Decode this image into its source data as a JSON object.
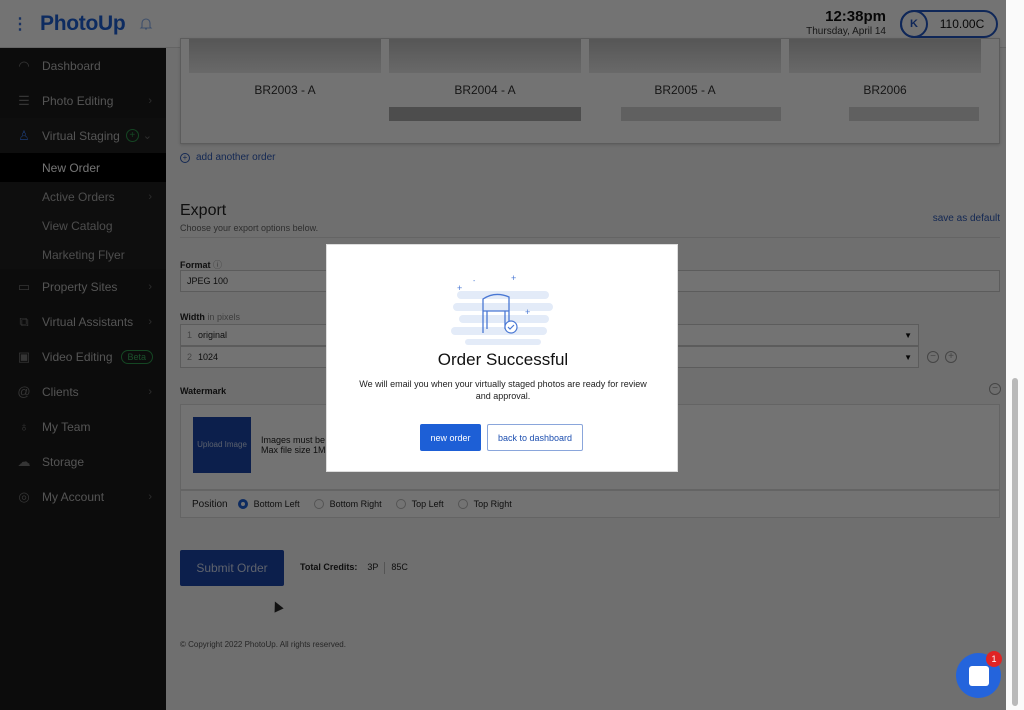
{
  "header": {
    "logo": "PhotoUp",
    "time": "12:38pm",
    "date": "Thursday, April 14",
    "avatar_initial": "K",
    "credits_balance": "110.00C"
  },
  "sidebar": {
    "items": [
      {
        "label": "Dashboard",
        "icon": "gauge-icon"
      },
      {
        "label": "Photo Editing",
        "icon": "sliders-icon"
      },
      {
        "label": "Virtual Staging",
        "icon": "chair-icon"
      },
      {
        "label": "Property Sites",
        "icon": "id-card-icon"
      },
      {
        "label": "Virtual Assistants",
        "icon": "assistant-icon"
      },
      {
        "label": "Video Editing",
        "icon": "video-icon",
        "badge": "Beta"
      },
      {
        "label": "Clients",
        "icon": "at-icon"
      },
      {
        "label": "My Team",
        "icon": "team-icon"
      },
      {
        "label": "Storage",
        "icon": "cloud-icon"
      },
      {
        "label": "My Account",
        "icon": "account-icon"
      }
    ],
    "virtual_staging_sub": [
      {
        "label": "New Order"
      },
      {
        "label": "Active Orders"
      },
      {
        "label": "View Catalog"
      },
      {
        "label": "Marketing Flyer"
      }
    ]
  },
  "catalog": {
    "items": [
      "BR2003 - A",
      "BR2004 - A",
      "BR2005 - A",
      "BR2006"
    ]
  },
  "add_another_order": "add another order",
  "export": {
    "title": "Export",
    "subtitle": "Choose your export options below.",
    "save_default": "save as default",
    "format_label": "Format",
    "format_value": "JPEG 100",
    "width_label": "Width",
    "width_hint": "in pixels",
    "widths": [
      {
        "n": "1",
        "value": "original"
      },
      {
        "n": "2",
        "value": "1024"
      }
    ],
    "watermark_label": "Watermark",
    "upload_label": "Upload Image",
    "watermark_note_1": "Images must be",
    "watermark_note_2": "Max file size 1M",
    "position_label": "Position",
    "positions": [
      "Bottom Left",
      "Bottom Right",
      "Top Left",
      "Top Right"
    ],
    "selected_position": "Bottom Left"
  },
  "submit": {
    "label": "Submit Order",
    "total_label": "Total Credits:",
    "total_p": "3P",
    "total_c": "85C"
  },
  "footer": {
    "copyright": "© Copyright 2022 PhotoUp. All rights reserved."
  },
  "modal": {
    "title": "Order Successful",
    "message": "We will email you when your virtually staged photos are ready for review and approval.",
    "new_order": "new order",
    "back_to_dashboard": "back to dashboard"
  },
  "chat": {
    "badge_count": "1"
  },
  "colors": {
    "brand": "#1d5fd6",
    "submit": "#1b45a8",
    "beta": "#2e9b4e",
    "badge": "#e02424"
  }
}
